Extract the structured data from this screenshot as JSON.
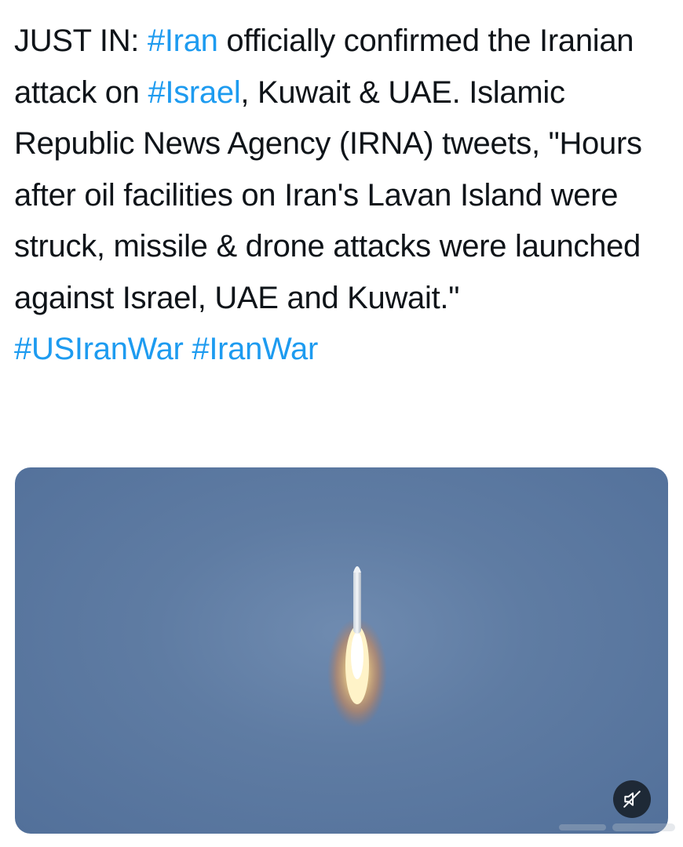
{
  "tweet": {
    "segments": [
      {
        "text": "JUST IN: ",
        "type": "text"
      },
      {
        "text": "#Iran",
        "type": "hashtag"
      },
      {
        "text": " officially confirmed the Iranian attack on ",
        "type": "text"
      },
      {
        "text": "#Israel",
        "type": "hashtag"
      },
      {
        "text": ", Kuwait & UAE. Islamic Republic News Agency (IRNA) tweets, \"Hours after oil facilities on Iran's Lavan Island were struck, missile & drone attacks were launched against Israel, UAE and Kuwait.\" ",
        "type": "text"
      },
      {
        "text": "#USIranWar",
        "type": "hashtag"
      },
      {
        "text": " ",
        "type": "text"
      },
      {
        "text": "#IranWar",
        "type": "hashtag"
      }
    ]
  },
  "media": {
    "kind": "video",
    "mute_icon": "speaker-muted-icon"
  },
  "colors": {
    "text": "#0f1419",
    "hashtag": "#1d9bf0",
    "sky": "#5f7ca3"
  }
}
